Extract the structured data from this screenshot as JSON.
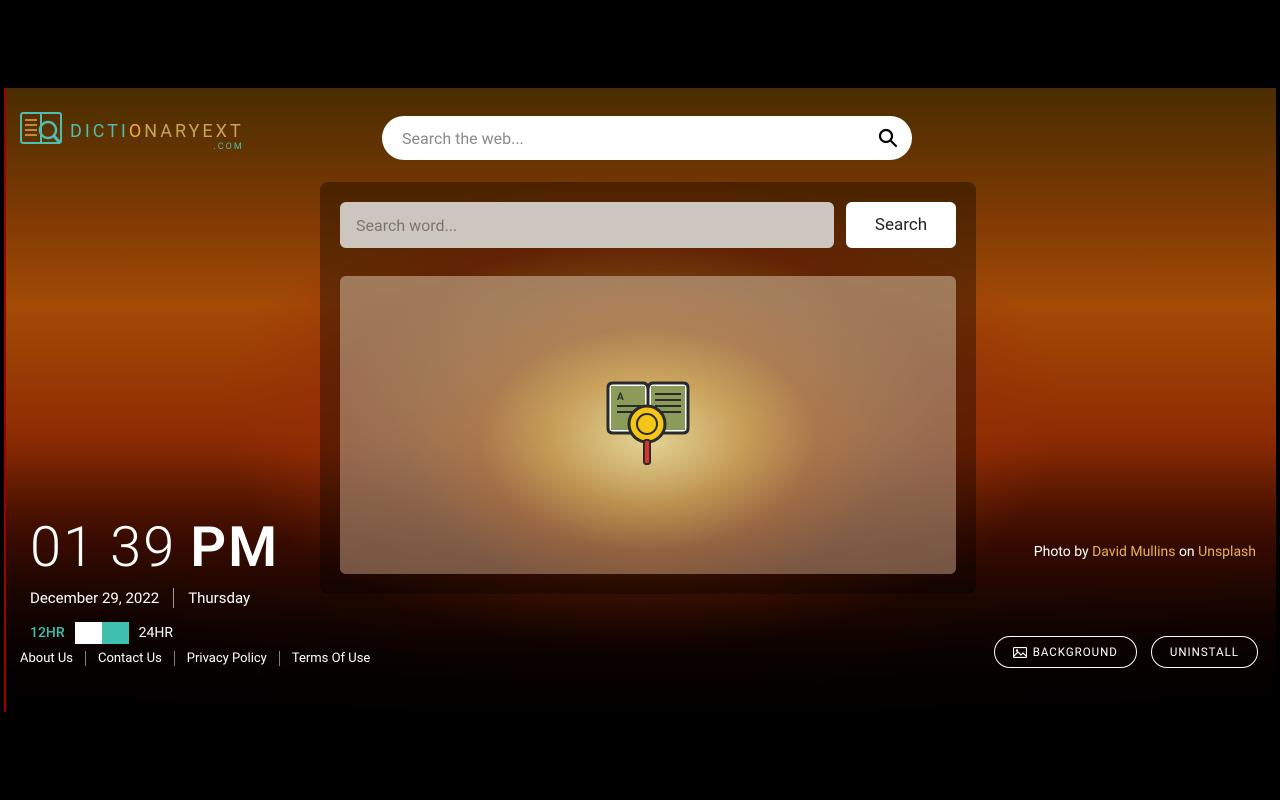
{
  "logo": {
    "dict": "DICTI",
    "o": "O",
    "rest": "NARYEXT",
    "sub": ".COM"
  },
  "web_search": {
    "placeholder": "Search the web..."
  },
  "dictionary": {
    "input_placeholder": "Search word...",
    "search_label": "Search"
  },
  "clock": {
    "hours": "01",
    "minutes": "39",
    "ampm": "PM",
    "date": "December 29, 2022",
    "weekday": "Thursday",
    "label_12": "12HR",
    "label_24": "24HR"
  },
  "footer": {
    "about": "About Us",
    "contact": "Contact Us",
    "privacy": "Privacy Policy",
    "terms": "Terms Of Use"
  },
  "photo_credit": {
    "prefix": "Photo by ",
    "author": "David Mullins",
    "middle": " on ",
    "site": "Unsplash"
  },
  "buttons": {
    "background": "BACKGROUND",
    "uninstall": "UNINSTALL"
  }
}
